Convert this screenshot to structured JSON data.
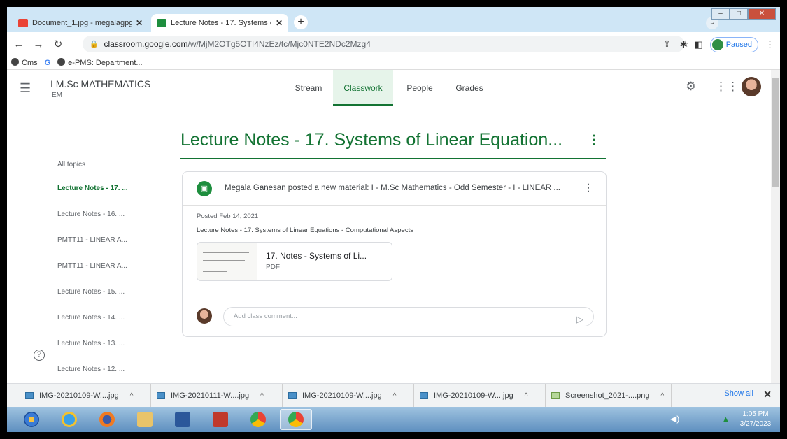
{
  "browser": {
    "tabs": [
      {
        "title": "Document_1.jpg - megalagpgd@",
        "favicon_color": "#ea4335"
      },
      {
        "title": "Lecture Notes - 17. Systems of Li",
        "favicon_color": "#1e8e3e"
      }
    ],
    "url_host": "classroom.google.com",
    "url_path": "/w/MjM2OTg5OTI4NzEz/tc/Mjc0NTE2NDc2Mzg4",
    "profile_status": "Paused",
    "bookmarks": [
      "Cms",
      "G",
      "e-PMS: Department..."
    ]
  },
  "classroom": {
    "course_title": "I M.Sc MATHEMATICS",
    "course_subtitle": "EM",
    "nav_tabs": [
      "Stream",
      "Classwork",
      "People",
      "Grades"
    ],
    "active_tab": "Classwork"
  },
  "topics": {
    "all_label": "All topics",
    "items": [
      "Lecture Notes - 17. ...",
      "Lecture Notes - 16. ...",
      "PMTT11 - LINEAR A...",
      "PMTT11 - LINEAR A...",
      "Lecture Notes - 15. ...",
      "Lecture Notes - 14. ...",
      "Lecture Notes - 13. ...",
      "Lecture Notes - 12. ..."
    ]
  },
  "main": {
    "title": "Lecture Notes - 17. Systems of Linear Equation...",
    "post_headline": "Megala Ganesan posted a new material: I - M.Sc Mathematics - Odd Semester - I - LINEAR ...",
    "posted_date": "Posted Feb 14, 2021",
    "description": "Lecture Notes - 17. Systems of Linear Equations - Computational Aspects",
    "attachment_title": "17. Notes - Systems of Li...",
    "attachment_type": "PDF",
    "comment_placeholder": "Add class comment..."
  },
  "downloads": {
    "items": [
      "IMG-20210109-W....jpg",
      "IMG-20210111-W....jpg",
      "IMG-20210109-W....jpg",
      "IMG-20210109-W....jpg",
      "Screenshot_2021-....png"
    ],
    "show_all": "Show all"
  },
  "taskbar": {
    "time": "1:05 PM",
    "date": "3/27/2023"
  },
  "colors": {
    "classroom_green": "#137333",
    "link_blue": "#1a73e8"
  }
}
